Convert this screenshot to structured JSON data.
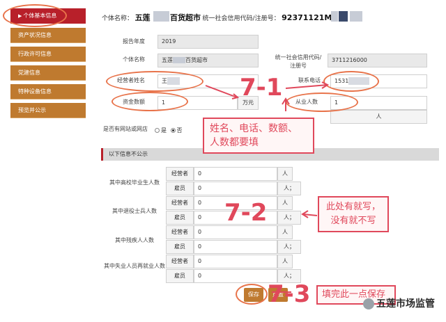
{
  "sidebar": {
    "items": [
      {
        "label": "个体基本信息",
        "active": true
      },
      {
        "label": "资产状况信息"
      },
      {
        "label": "行政许可信息"
      },
      {
        "label": "党建信息"
      },
      {
        "label": "特种设备信息"
      },
      {
        "label": "预览并公示"
      }
    ]
  },
  "header": {
    "name_label": "个体名称：",
    "name_prefix": "五莲",
    "name_suffix": "百货超市",
    "code_label": "统一社会信用代码/注册号：",
    "code_value": "92371121MA"
  },
  "form": {
    "year_label": "报告年度",
    "year_value": "2019",
    "name_label": "个体名称",
    "name_value_prefix": "五莲",
    "name_value_suffix": "百货超市",
    "code_label": "统一社会信用代码/注册号",
    "code_value": "3711216000",
    "operator_label": "经营者姓名",
    "operator_value": "王",
    "phone_label": "联系电话",
    "phone_value": "1531",
    "capital_label": "资金数额",
    "capital_value": "1",
    "capital_unit": "万元",
    "employees_label": "从业人数",
    "employees_value": "1",
    "employees_unit": "人",
    "website_label": "是否有网站或网店",
    "website_yes": "是",
    "website_no": "否",
    "website_selected": "否"
  },
  "section": {
    "title": "以下信息不公示"
  },
  "stats": [
    {
      "label": "其中高校毕业生人数",
      "operator_label": "经营者",
      "operator_value": "0",
      "operator_unit": "人",
      "employee_label": "雇员",
      "employee_value": "0",
      "employee_unit": "人；"
    },
    {
      "label": "其中退役士兵人数",
      "operator_label": "经营者",
      "operator_value": "0",
      "operator_unit": "人",
      "employee_label": "雇员",
      "employee_value": "0",
      "employee_unit": "人；"
    },
    {
      "label": "其中残疾人人数",
      "operator_label": "经营者",
      "operator_value": "0",
      "operator_unit": "人",
      "employee_label": "雇员",
      "employee_value": "0",
      "employee_unit": "人；"
    },
    {
      "label": "其中失业人员再就业人数",
      "operator_label": "经营者",
      "operator_value": "0",
      "operator_unit": "人",
      "employee_label": "雇员",
      "employee_value": "0",
      "employee_unit": "人；"
    }
  ],
  "buttons": {
    "save": "保存",
    "reset": "重置"
  },
  "annotations": {
    "step1": "7-1",
    "step1_note_line1": "姓名、电话、数额、",
    "step1_note_line2": "人数都要填",
    "step2": "7-2",
    "step2_note_line1": "此处有就写，",
    "step2_note_line2": "没有就不写",
    "step3": "7-3",
    "step3_note": "填完此一点保存"
  },
  "watermark": {
    "text": "五莲市场监管"
  },
  "colors": {
    "sidebar_bg": "#bf7a2f",
    "sidebar_active": "#b8202a",
    "annotation": "#e0485b",
    "oval": "#e8734a"
  }
}
